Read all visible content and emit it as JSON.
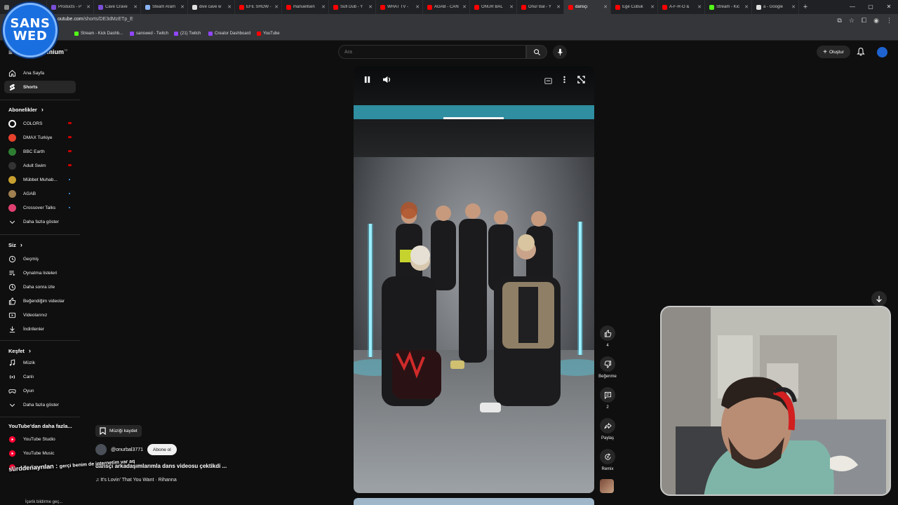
{
  "browser": {
    "tabs": [
      {
        "title": "",
        "color": "#888888"
      },
      {
        "title": "Products - P",
        "color": "#7b4fd8"
      },
      {
        "title": "Cave Crave",
        "color": "#7b4fd8"
      },
      {
        "title": "Steam Aram",
        "color": "#8ab4f8"
      },
      {
        "title": "dive cave w",
        "color": "#e0e0e0"
      },
      {
        "title": "EFE SHOW -",
        "color": "#ff0000"
      },
      {
        "title": "manuellsen",
        "color": "#ff0000"
      },
      {
        "title": "Sufi Dub - Y",
        "color": "#ff0000"
      },
      {
        "title": "WHAT TV -",
        "color": "#ff0000"
      },
      {
        "title": "AGAB - CAN",
        "color": "#ff0000"
      },
      {
        "title": "ONUR BAL",
        "color": "#ff0000"
      },
      {
        "title": "Onur Bal - Y",
        "color": "#ff0000"
      },
      {
        "title": "dansçı",
        "color": "#ff0000",
        "active": true
      },
      {
        "title": "Ege Cubuk",
        "color": "#ff0000"
      },
      {
        "title": "A-F-R-O &",
        "color": "#ff0000"
      },
      {
        "title": "Stream - Kic",
        "color": "#53fc18"
      },
      {
        "title": "a - Google",
        "color": "#e0e0e0"
      }
    ],
    "url_host": "outube.com",
    "url_path": "/shorts/DE3dMzETp_E",
    "bookmarks": [
      {
        "label": "Stream - Kick Dashb...",
        "color": "#53fc18"
      },
      {
        "label": "sanswed - Twitch",
        "color": "#9146ff"
      },
      {
        "label": "(21) Twitch",
        "color": "#9146ff"
      },
      {
        "label": "Creator Dashboard",
        "color": "#9146ff"
      },
      {
        "label": "YouTube",
        "color": "#ff0000"
      }
    ]
  },
  "overlay_logo": {
    "line1": "SANS",
    "line2": "WED"
  },
  "header": {
    "brand": "emium",
    "brand_sup": "TR",
    "search_placeholder": "Ara",
    "create_label": "Oluştur"
  },
  "sidebar": {
    "main": [
      {
        "label": "Ana Sayfa",
        "icon": "home-icon"
      },
      {
        "label": "Shorts",
        "icon": "shorts-icon",
        "active": true
      }
    ],
    "subs_title": "Abonelikler",
    "subs": [
      {
        "label": "COLORS",
        "color": "#ffffff",
        "badge": "live"
      },
      {
        "label": "DMAX Turkiye",
        "color": "#e8412c",
        "badge": "live"
      },
      {
        "label": "BBC Earth",
        "color": "#2e7d32",
        "badge": "live"
      },
      {
        "label": "Adult Swim",
        "color": "#333333",
        "badge": "live"
      },
      {
        "label": "Mübbet Muhab...",
        "color": "#c8a030",
        "badge": "dot"
      },
      {
        "label": "AGAB",
        "color": "#a08050",
        "badge": "dot"
      },
      {
        "label": "Crossover Talks",
        "color": "#e04070",
        "badge": "dot"
      }
    ],
    "subs_more": "Daha fazla göster",
    "you_title": "Siz",
    "you": [
      {
        "label": "Geçmiş",
        "icon": "history-icon"
      },
      {
        "label": "Oynatma listeleri",
        "icon": "playlist-icon"
      },
      {
        "label": "Daha sonra izle",
        "icon": "clock-icon"
      },
      {
        "label": "Beğendiğim videolar",
        "icon": "like-icon"
      },
      {
        "label": "Videolarınız",
        "icon": "video-icon"
      },
      {
        "label": "İndirilenler",
        "icon": "download-icon"
      }
    ],
    "explore_title": "Keşfet",
    "explore": [
      {
        "label": "Müzik",
        "icon": "music-icon"
      },
      {
        "label": "Canlı",
        "icon": "live-icon"
      },
      {
        "label": "Oyun",
        "icon": "game-icon"
      }
    ],
    "explore_more": "Daha fazla göster",
    "more_title": "YouTube'dan daha fazla...",
    "more": [
      {
        "label": "YouTube Studio"
      },
      {
        "label": "YouTube Music"
      },
      {
        "label": "YouTube Kids"
      }
    ],
    "bottom_note": "İçerik bildirme geç..."
  },
  "short": {
    "save_music": "Müziği kaydet",
    "channel": "@onurbal3771",
    "subscribe": "Abone ol",
    "title": "dansçı arkadaşımlarımla  dans videosu çektikdi ...",
    "song": "♫ It's Lovin' That You Want · Rihanna",
    "actions": {
      "like_count": "4",
      "dislike_label": "Beğenme",
      "comment_count": "2",
      "share_label": "Paylaş",
      "remix_label": "Remix"
    }
  },
  "chat_overlay": {
    "user": "sürddenayrılan :",
    "message": "gerçi benim de internetim var aq"
  }
}
